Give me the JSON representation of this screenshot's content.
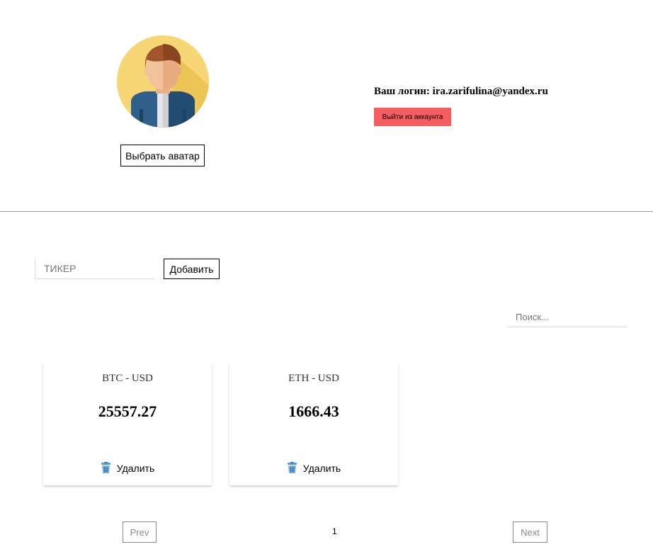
{
  "profile": {
    "choose_avatar_label": "Выбрать аватар",
    "login_text": "Ваш логин: ira.zarifulina@yandex.ru",
    "logout_label": "Выйти из аккаунта",
    "logout_color": "#f65e61",
    "avatar_icon": "user-avatar-icon"
  },
  "ticker_form": {
    "placeholder": "ТИКЕР",
    "add_label": "Добавить"
  },
  "search": {
    "placeholder": "Поиск..."
  },
  "cards": [
    {
      "pair": "BTC - USD",
      "price": "25557.27",
      "delete_label": "Удалить",
      "icon": "trash-icon"
    },
    {
      "pair": "ETH - USD",
      "price": "1666.43",
      "delete_label": "Удалить",
      "icon": "trash-icon"
    }
  ],
  "pagination": {
    "prev_label": "Prev",
    "page": "1",
    "next_label": "Next"
  }
}
